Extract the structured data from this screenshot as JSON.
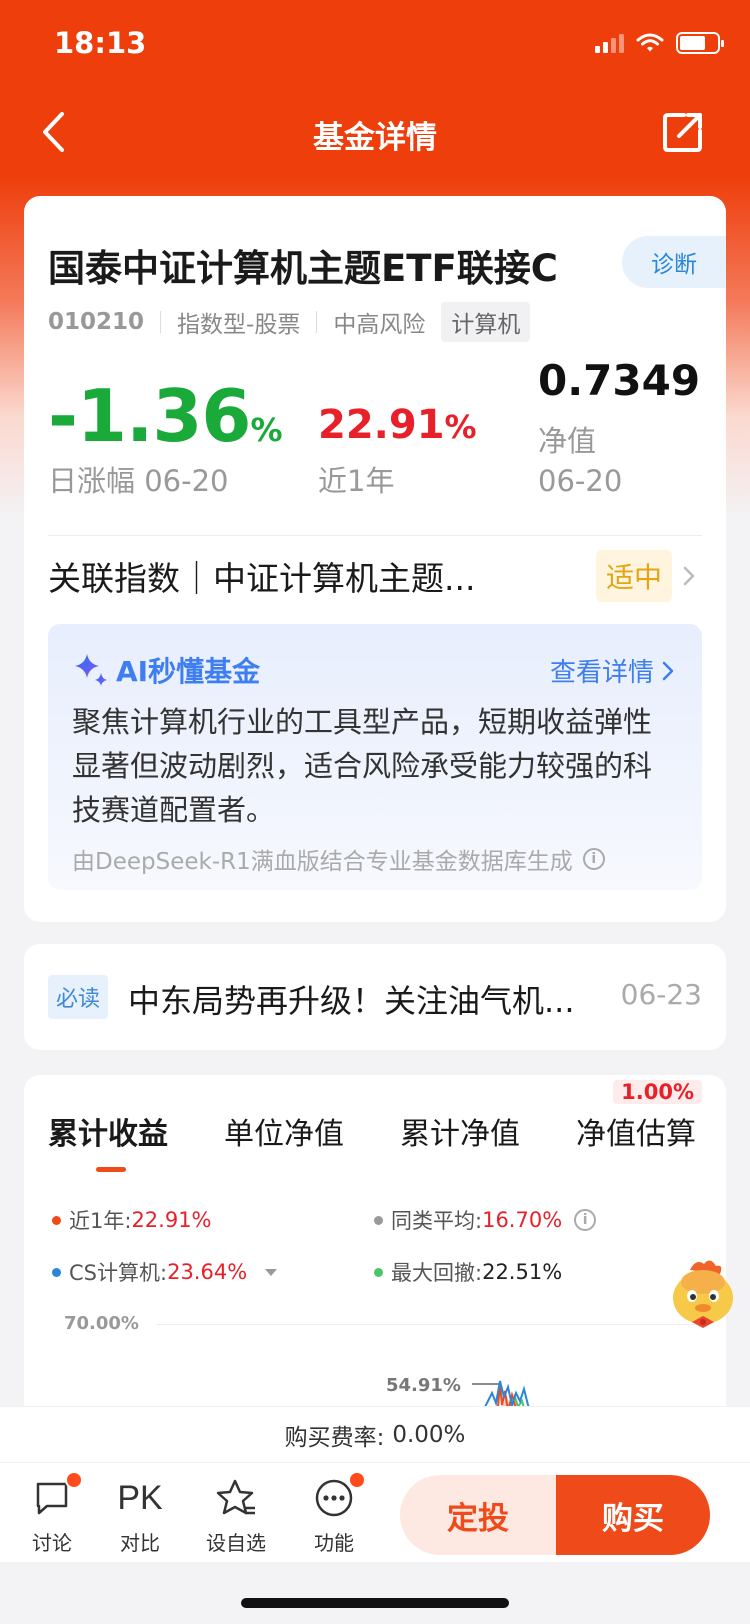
{
  "status_bar": {
    "time": "18:13"
  },
  "nav": {
    "title": "基金详情"
  },
  "fund": {
    "name": "国泰中证计算机主题ETF联接C",
    "diagnose_label": "诊断",
    "code": "010210",
    "type": "指数型-股票",
    "risk": "中高风险",
    "industry_tag": "计算机"
  },
  "stats": {
    "daily_change_value": "-1.36",
    "daily_change_unit": "%",
    "daily_change_label": "日涨幅 06-20",
    "one_year_value": "22.91",
    "one_year_unit": "%",
    "one_year_label": "近1年",
    "nav_value": "0.7349",
    "nav_label": "净值",
    "nav_date": "06-20"
  },
  "index_row": {
    "text": "关联指数｜中证计算机主题...",
    "badge": "适中"
  },
  "ai": {
    "title": "AI秒懂基金",
    "link_label": "查看详情",
    "body": "聚焦计算机行业的工具型产品，短期收益弹性显著但波动剧烈，适合风险承受能力较强的科技赛道配置者。",
    "note": "由DeepSeek-R1满血版结合专业基金数据库生成"
  },
  "news": {
    "tag": "必读",
    "title": "中东局势再升级！关注油气机...",
    "date": "06-23"
  },
  "tabs": {
    "items": [
      "累计收益",
      "单位净值",
      "累计净值",
      "净值估算"
    ],
    "active_index": 0,
    "estimate_badge": "1.00%"
  },
  "legend": {
    "one_year": {
      "label": "近1年:",
      "value": "22.91%",
      "color": "#ee4a1a"
    },
    "peer_avg": {
      "label": "同类平均:",
      "value": "16.70%",
      "color": "#999999"
    },
    "index": {
      "label": "CS计算机:",
      "value": "23.64%",
      "color": "#2a86d9"
    },
    "max_drawdown": {
      "label": "最大回撤:",
      "value": "22.51%",
      "color": "#4cc46a"
    }
  },
  "chart_data": {
    "type": "line",
    "y_tick_top": "70.00%",
    "peak_annotation": "54.91%",
    "ylim_top": 70.0,
    "peak_value": 54.91,
    "series": [
      {
        "name": "近1年",
        "color": "#ee4a1a"
      },
      {
        "name": "CS计算机",
        "color": "#2a86d9"
      },
      {
        "name": "最大回撤",
        "color": "#4cc46a"
      }
    ]
  },
  "fee": {
    "label": "购买费率:",
    "value": "0.00%"
  },
  "bottom_bar": {
    "discuss": "讨论",
    "pk_text": "PK",
    "compare": "对比",
    "watchlist": "设自选",
    "functions": "功能",
    "sip_button": "定投",
    "buy_button": "购买"
  },
  "colors": {
    "brand": "#ee4a1a",
    "rise": "#e8202a",
    "fall": "#1aaa3a",
    "ai_blue": "#3e7ef0"
  },
  "icons": [
    "back-icon",
    "share-icon",
    "sparkle-icon",
    "chevron-right-icon",
    "info-icon",
    "discuss-icon",
    "star-icon",
    "more-icon",
    "mascot-icon"
  ]
}
